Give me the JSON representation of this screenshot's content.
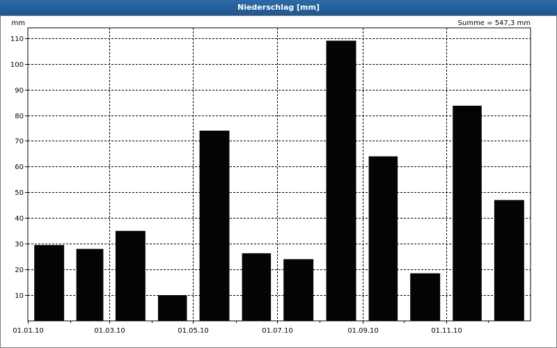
{
  "window": {
    "title": "Niederschlag [mm]"
  },
  "chart_data": {
    "type": "bar",
    "title": "Niederschlag [mm]",
    "ylabel": "mm",
    "annotation": "Summe = 547,3 mm",
    "x_tick_labels": [
      "01.01.10",
      "01.03.10",
      "01.05.10",
      "01.07.10",
      "01.09.10",
      "01.11.10"
    ],
    "y_ticks": [
      10,
      20,
      30,
      40,
      50,
      60,
      70,
      80,
      90,
      100,
      110
    ],
    "ylim": [
      0,
      114
    ],
    "grid": true,
    "categories": [
      "2010-01",
      "2010-02",
      "2010-03",
      "2010-04",
      "2010-05",
      "2010-06",
      "2010-07",
      "2010-08",
      "2010-09",
      "2010-10",
      "2010-11",
      "2010-12"
    ],
    "values": [
      29.5,
      28,
      35,
      10,
      74,
      26.3,
      24,
      109,
      64,
      18.5,
      83.7,
      47
    ],
    "bar_color": "#050305"
  }
}
